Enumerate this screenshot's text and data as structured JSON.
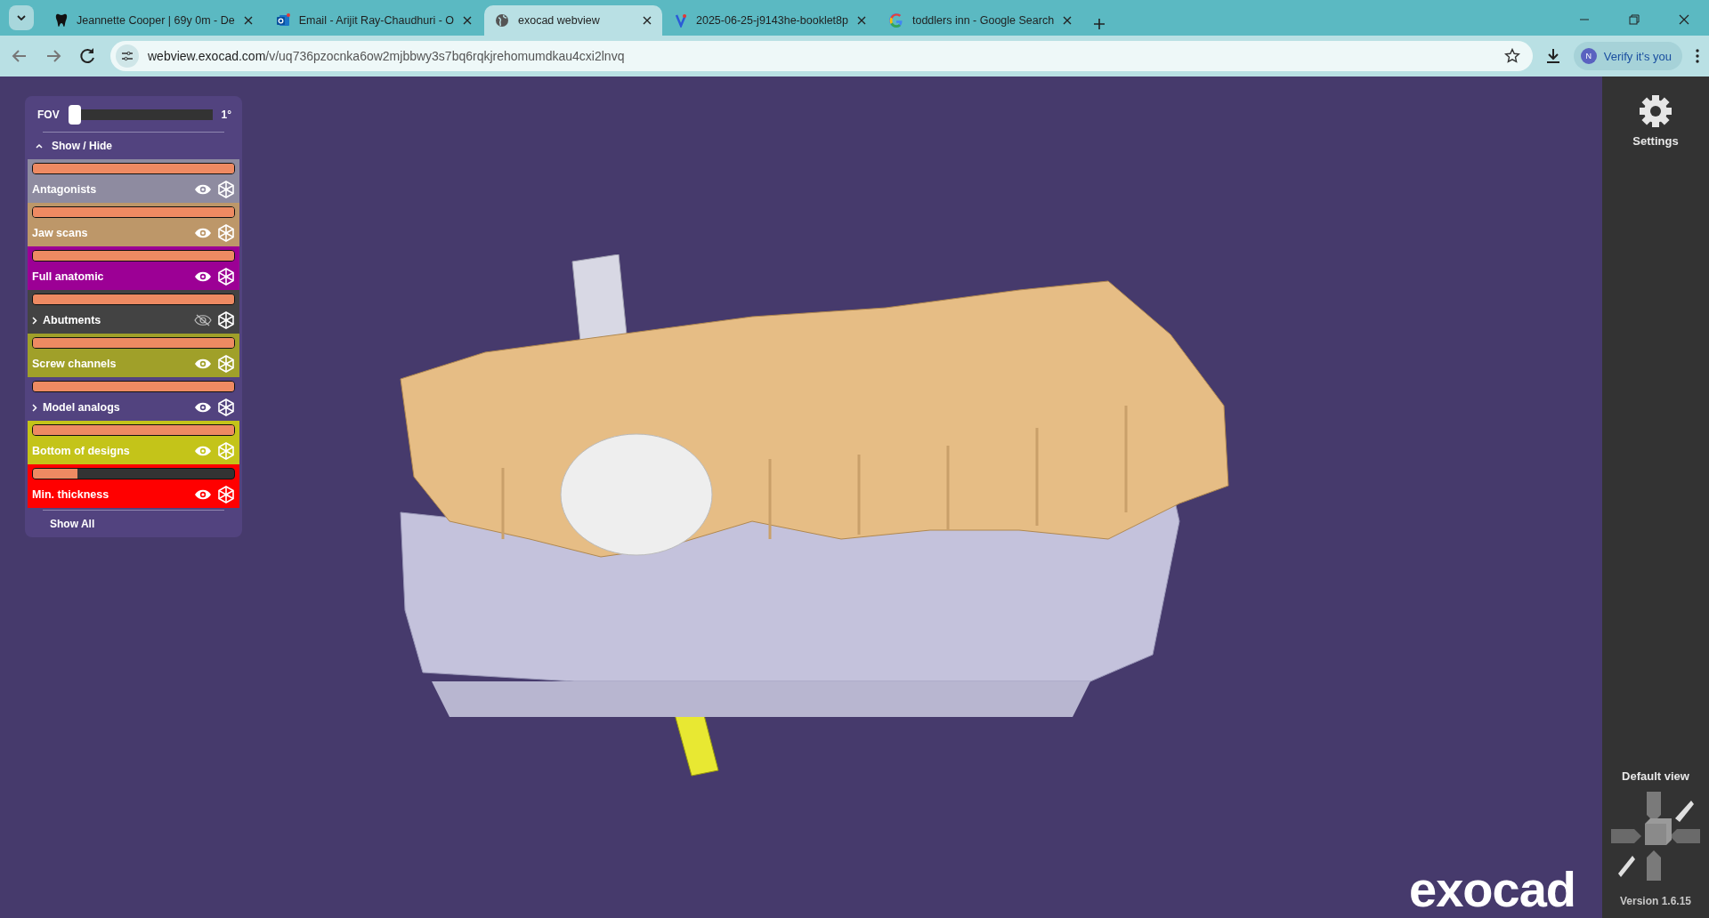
{
  "browser": {
    "tabs": [
      {
        "title": "Jeannette Cooper | 69y 0m - De",
        "selected": false
      },
      {
        "title": "Email - Arijit Ray-Chaudhuri - O",
        "selected": false
      },
      {
        "title": "exocad webview",
        "selected": true
      },
      {
        "title": "2025-06-25-j9143he-booklet8p",
        "selected": false
      },
      {
        "title": "toddlers inn - Google Search",
        "selected": false
      }
    ],
    "url_host": "webview.exocad.com",
    "url_path": "/v/uq736pzocnka6ow2mjbbwy3s7bq6rqkjrehomumdkau4cxi2lnvq",
    "profile_initial": "N",
    "profile_label": "Verify it's you"
  },
  "fov": {
    "label": "FOV",
    "level": 0.0,
    "reading": "1°"
  },
  "show_hide": {
    "label": "Show / Hide",
    "expanded": true
  },
  "layers": [
    {
      "name": "Antagonists",
      "kind": "layer",
      "color": "#8e8ba0",
      "level": 1.0,
      "visible": true
    },
    {
      "name": "Jaw scans",
      "kind": "layer",
      "color": "#bd9769",
      "level": 1.0,
      "visible": true
    },
    {
      "name": "Full anatomic",
      "kind": "layer",
      "color": "#9c0095",
      "level": 1.0,
      "visible": true
    },
    {
      "name": "Abutments",
      "kind": "group",
      "color": "#434343",
      "level": 1.0,
      "visible": false
    },
    {
      "name": "Screw channels",
      "kind": "layer",
      "color": "#a0a029",
      "level": 1.0,
      "visible": true
    },
    {
      "name": "Model analogs",
      "kind": "group",
      "color": "#52437f",
      "level": 1.0,
      "visible": true
    },
    {
      "name": "Bottom of designs",
      "kind": "layer",
      "color": "#c4c419",
      "level": 1.0,
      "visible": true
    },
    {
      "name": "Min. thickness",
      "kind": "layer",
      "color": "#ff0000",
      "level": 0.22,
      "visible": true
    }
  ],
  "show_all": "Show All",
  "settings": "Settings",
  "default_view": "Default view",
  "version": "Version 1.6.15",
  "logo": "exocad"
}
